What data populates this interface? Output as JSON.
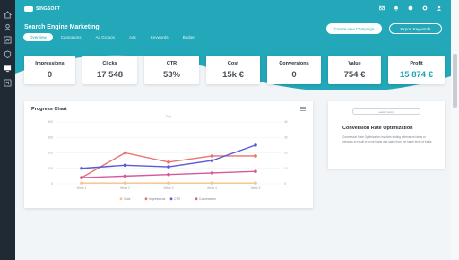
{
  "app": {
    "logo_text": "SINGSOFT"
  },
  "sidebar": {
    "items": [
      {
        "icon": "home-icon",
        "active": false
      },
      {
        "icon": "user-icon",
        "active": false
      },
      {
        "icon": "chart-icon",
        "active": false
      },
      {
        "icon": "shield-icon",
        "active": false
      },
      {
        "icon": "monitor-icon",
        "active": true
      },
      {
        "icon": "settings-icon",
        "active": false
      }
    ]
  },
  "header": {
    "title": "Search Engine Marketing",
    "tabs": [
      {
        "label": "Overview",
        "active": true
      },
      {
        "label": "Campaigns",
        "active": false
      },
      {
        "label": "Ad Groups",
        "active": false
      },
      {
        "label": "Ads",
        "active": false
      },
      {
        "label": "Keywords",
        "active": false
      },
      {
        "label": "Budget",
        "active": false
      }
    ],
    "create_button": "Create new Campaign",
    "export_button": "Export Keywords",
    "top_icons": [
      "mail-icon",
      "bell-icon",
      "help-icon",
      "gear-icon",
      "user-icon"
    ],
    "accent_color": "#22a8b8"
  },
  "stats": [
    {
      "label": "Impressions",
      "value": "0"
    },
    {
      "label": "Clicks",
      "value": "17 548"
    },
    {
      "label": "CTR",
      "value": "53%"
    },
    {
      "label": "Cost",
      "value": "15k €"
    },
    {
      "label": "Conversions",
      "value": "0"
    },
    {
      "label": "Value",
      "value": "754 €"
    },
    {
      "label": "Profit",
      "value": "15 874 €",
      "accent": true
    }
  ],
  "chart_card": {
    "title": "Progress Chart"
  },
  "chart_data": {
    "type": "line",
    "title": "",
    "subtitle": "Day",
    "x": [
      "Week 1",
      "Week 2",
      "Week 3",
      "Week 4",
      "Week 5"
    ],
    "y_left_ticks": [
      "400",
      "300",
      "200",
      "100",
      "0"
    ],
    "y_right_ticks": [
      "40",
      "30",
      "20",
      "10",
      "0"
    ],
    "ylim": [
      0,
      400
    ],
    "grid": true,
    "legend_position": "bottom",
    "series": [
      {
        "name": "Click",
        "color": "#f5c28a",
        "values": [
          5,
          5,
          5,
          5,
          5
        ]
      },
      {
        "name": "Impressions",
        "color": "#e8736f",
        "values": [
          40,
          200,
          140,
          180,
          180
        ]
      },
      {
        "name": "CTR",
        "color": "#5a5ad6",
        "values": [
          100,
          120,
          110,
          150,
          250
        ]
      },
      {
        "name": "Conversions",
        "color": "#d45a9a",
        "values": [
          40,
          50,
          60,
          70,
          80
        ]
      }
    ]
  },
  "info_card": {
    "search_placeholder": "search terms",
    "title": "Conversion Rate Optimization",
    "body": "Conversion Rate Optimization involves testing alternative ideas or versions to result in more leads and sales from the same level of traffic."
  }
}
